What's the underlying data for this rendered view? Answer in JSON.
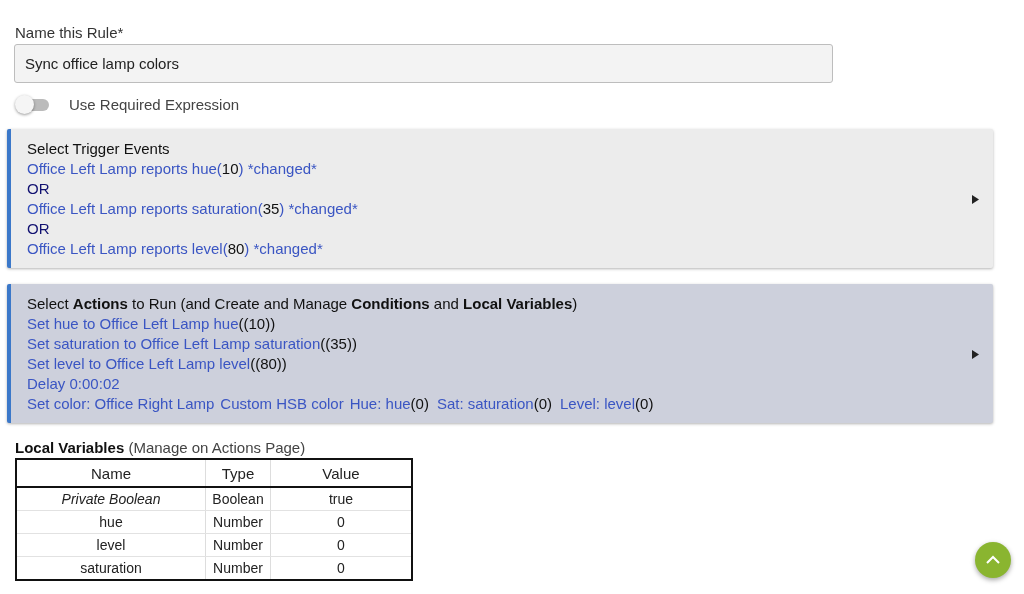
{
  "name_field": {
    "label": "Name this Rule*",
    "value": "Sync office lamp colors"
  },
  "required_expression": {
    "label": "Use Required Expression",
    "on": false
  },
  "trigger_card": {
    "title": "Select Trigger Events",
    "expanded": false,
    "lines": [
      {
        "parts": [
          {
            "kind": "link",
            "text": "Office Left Lamp reports hue("
          },
          {
            "kind": "value",
            "text": "10"
          },
          {
            "kind": "link",
            "text": ") *changed*"
          }
        ]
      },
      {
        "parts": [
          {
            "kind": "operator",
            "text": "OR"
          }
        ]
      },
      {
        "parts": [
          {
            "kind": "link",
            "text": "Office Left Lamp reports saturation("
          },
          {
            "kind": "value",
            "text": "35"
          },
          {
            "kind": "link",
            "text": ") *changed*"
          }
        ]
      },
      {
        "parts": [
          {
            "kind": "operator",
            "text": "OR"
          }
        ]
      },
      {
        "parts": [
          {
            "kind": "link",
            "text": "Office Left Lamp reports level("
          },
          {
            "kind": "value",
            "text": "80"
          },
          {
            "kind": "link",
            "text": ") *changed*"
          }
        ]
      }
    ]
  },
  "actions_card": {
    "title": "Select **Actions** to Run (and Create and Manage **Conditions** and **Local Variables**)",
    "expanded": false,
    "lines": [
      {
        "parts": [
          {
            "kind": "link",
            "text": "Set hue to Office Left Lamp hue"
          },
          {
            "kind": "value",
            "text": "((10))"
          }
        ]
      },
      {
        "parts": [
          {
            "kind": "link",
            "text": "Set saturation to Office Left Lamp saturation"
          },
          {
            "kind": "value",
            "text": "((35))"
          }
        ]
      },
      {
        "parts": [
          {
            "kind": "link",
            "text": "Set level to Office Left Lamp level"
          },
          {
            "kind": "value",
            "text": "((80))"
          }
        ]
      },
      {
        "parts": [
          {
            "kind": "link",
            "text": "Delay 0:00:02"
          }
        ]
      },
      {
        "parts": [
          {
            "kind": "link",
            "text": "Set color: Office Right Lamp"
          },
          {
            "kind": "link",
            "text": "Custom HSB color"
          },
          {
            "kind": "link",
            "text": "Hue: hue"
          },
          {
            "kind": "value",
            "text": "(0)"
          },
          {
            "kind": "link",
            "text": "Sat: saturation"
          },
          {
            "kind": "value",
            "text": "(0)"
          },
          {
            "kind": "link",
            "text": "Level: level"
          },
          {
            "kind": "value",
            "text": "(0)"
          }
        ]
      }
    ]
  },
  "local_variables": {
    "heading": "**Local Variables** (Manage on Actions Page)",
    "columns": [
      "Name",
      "Type",
      "Value"
    ],
    "rows": [
      {
        "kind": "builtin",
        "cells": [
          "Private Boolean",
          "Boolean",
          "true"
        ]
      },
      {
        "kind": "variable",
        "cells": [
          "hue",
          "Number",
          "0"
        ]
      },
      {
        "kind": "variable",
        "cells": [
          "level",
          "Number",
          "0"
        ]
      },
      {
        "kind": "variable",
        "cells": [
          "saturation",
          "Number",
          "0"
        ]
      }
    ]
  }
}
